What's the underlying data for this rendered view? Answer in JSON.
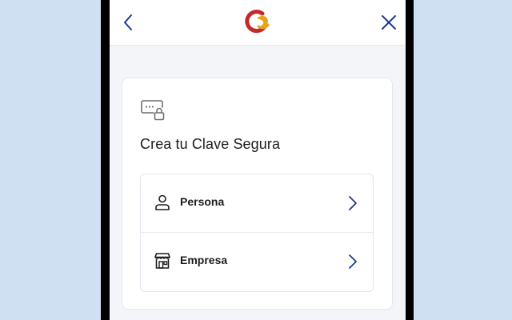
{
  "header": {
    "back_icon": "chevron-left-icon",
    "logo_icon": "app-logo",
    "close_icon": "close-icon"
  },
  "card": {
    "icon": "password-lock-icon",
    "title": "Crea tu Clave Segura",
    "options": [
      {
        "label": "Persona",
        "icon": "person-icon"
      },
      {
        "label": "Empresa",
        "icon": "store-icon"
      }
    ]
  },
  "colors": {
    "accent": "#1f3a8c",
    "logo_red": "#c62828",
    "logo_gold": "#e8a317",
    "page_background": "#cfe0f3",
    "screen_background": "#f3f5f8"
  }
}
